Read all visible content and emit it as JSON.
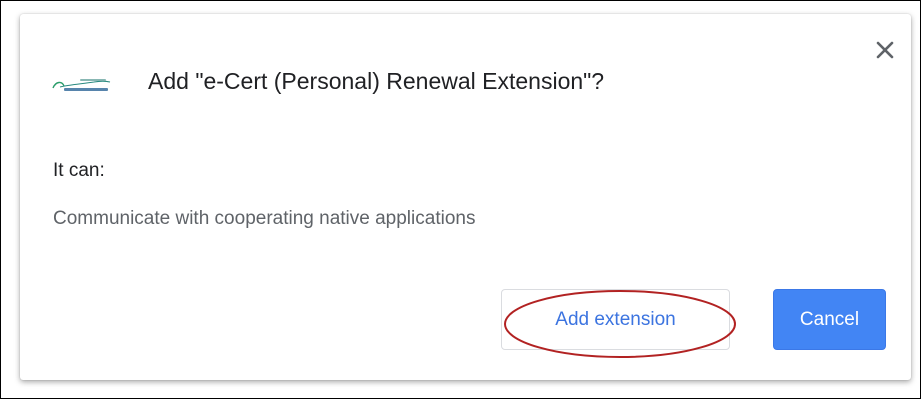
{
  "dialog": {
    "title": "Add \"e-Cert (Personal) Renewal Extension\"?",
    "it_can_label": "It can:",
    "permissions": [
      "Communicate with cooperating native applications"
    ],
    "close_icon": "close-icon",
    "logo_icon": "extension-logo-icon"
  },
  "buttons": {
    "add_label": "Add extension",
    "cancel_label": "Cancel"
  },
  "colors": {
    "accent": "#4285f4",
    "link_text": "#3c74e0",
    "highlight_ring": "#b22222"
  }
}
